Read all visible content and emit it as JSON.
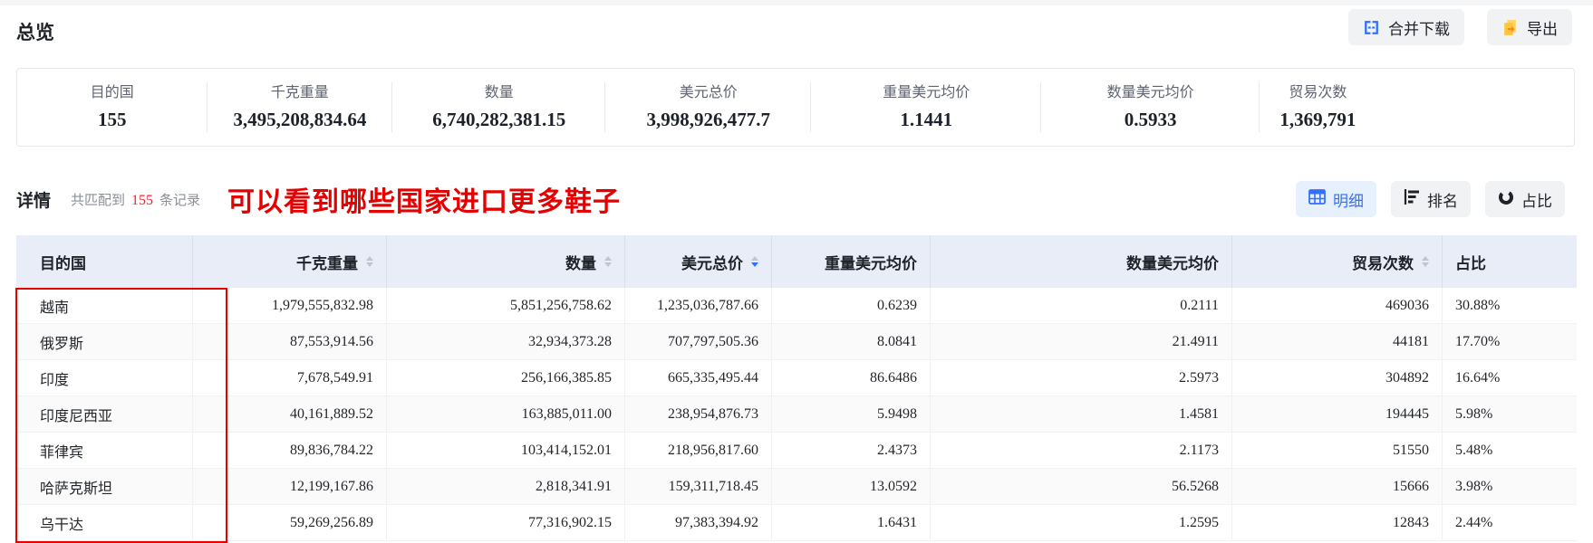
{
  "page": {
    "overview_title": "总览",
    "details_title": "详情"
  },
  "toolbar": {
    "merge_download_label": "合并下载",
    "export_label": "导出"
  },
  "stats": [
    {
      "label": "目的国",
      "value": "155"
    },
    {
      "label": "千克重量",
      "value": "3,495,208,834.64"
    },
    {
      "label": "数量",
      "value": "6,740,282,381.15"
    },
    {
      "label": "美元总价",
      "value": "3,998,926,477.7"
    },
    {
      "label": "重量美元均价",
      "value": "1.1441"
    },
    {
      "label": "数量美元均价",
      "value": "0.5933"
    },
    {
      "label": "贸易次数",
      "value": "1,369,791"
    }
  ],
  "details": {
    "match_prefix": "共匹配到",
    "match_count": "155",
    "match_suffix": "条记录",
    "annotation": "可以看到哪些国家进口更多鞋子",
    "view_tabs": [
      {
        "label": "明细",
        "active": true
      },
      {
        "label": "排名",
        "active": false
      },
      {
        "label": "占比",
        "active": false
      }
    ]
  },
  "table": {
    "columns": [
      "目的国",
      "千克重量",
      "数量",
      "美元总价",
      "重量美元均价",
      "数量美元均价",
      "贸易次数",
      "占比"
    ],
    "sorted_column": "美元总价",
    "sort_direction": "desc",
    "rows": [
      {
        "country": "越南",
        "kg": "1,979,555,832.98",
        "qty": "5,851,256,758.62",
        "usd": "1,235,036,787.66",
        "kg_avg": "0.6239",
        "qty_avg": "0.2111",
        "trades": "469036",
        "share": "30.88%"
      },
      {
        "country": "俄罗斯",
        "kg": "87,553,914.56",
        "qty": "32,934,373.28",
        "usd": "707,797,505.36",
        "kg_avg": "8.0841",
        "qty_avg": "21.4911",
        "trades": "44181",
        "share": "17.70%"
      },
      {
        "country": "印度",
        "kg": "7,678,549.91",
        "qty": "256,166,385.85",
        "usd": "665,335,495.44",
        "kg_avg": "86.6486",
        "qty_avg": "2.5973",
        "trades": "304892",
        "share": "16.64%"
      },
      {
        "country": "印度尼西亚",
        "kg": "40,161,889.52",
        "qty": "163,885,011.00",
        "usd": "238,954,876.73",
        "kg_avg": "5.9498",
        "qty_avg": "1.4581",
        "trades": "194445",
        "share": "5.98%"
      },
      {
        "country": "菲律宾",
        "kg": "89,836,784.22",
        "qty": "103,414,152.01",
        "usd": "218,956,817.60",
        "kg_avg": "2.4373",
        "qty_avg": "2.1173",
        "trades": "51550",
        "share": "5.48%"
      },
      {
        "country": "哈萨克斯坦",
        "kg": "12,199,167.86",
        "qty": "2,818,341.91",
        "usd": "159,311,718.45",
        "kg_avg": "13.0592",
        "qty_avg": "56.5268",
        "trades": "15666",
        "share": "3.98%"
      },
      {
        "country": "乌干达",
        "kg": "59,269,256.89",
        "qty": "77,316,902.15",
        "usd": "97,383,394.92",
        "kg_avg": "1.6431",
        "qty_avg": "1.2595",
        "trades": "12843",
        "share": "2.44%"
      }
    ]
  },
  "icons": {
    "merge_download": "merge-brackets",
    "export": "document-arrow",
    "detail_tab": "table-grid",
    "rank_tab": "bar-ranking",
    "share_tab": "donut-chart",
    "sort": "caret-up-down"
  },
  "colors": {
    "accent_blue": "#3370ff",
    "annotation_red": "#e60000",
    "count_red": "#f5222d",
    "export_yellow": "#ffc53d",
    "table_header_bg": "#e9edf8",
    "button_bg": "#f1f2f4",
    "active_tab_bg": "#e7f0fd"
  }
}
